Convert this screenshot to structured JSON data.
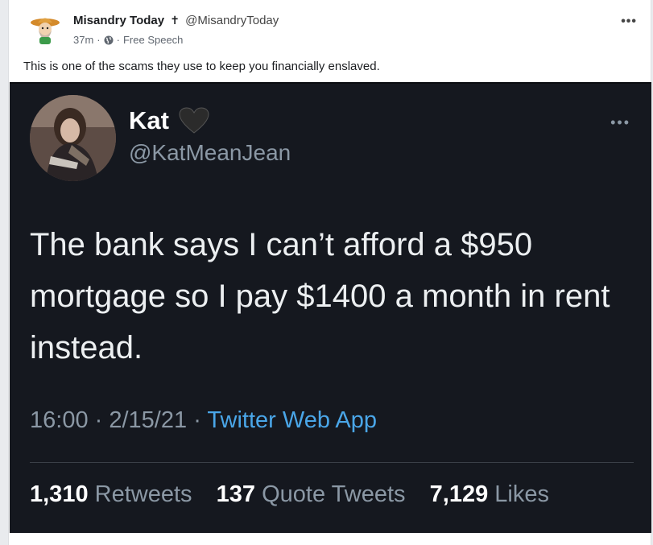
{
  "post": {
    "author_name": "Misandry Today",
    "author_cross": "✝",
    "author_handle": "@MisandryToday",
    "time": "37m",
    "separator": "·",
    "audience": "Free Speech",
    "more": "•••",
    "caption": "This is one of the scams they use to keep you financially enslaved."
  },
  "tweet": {
    "name": "Kat",
    "handle": "@KatMeanJean",
    "more": "•••",
    "text": "The bank says I can’t afford a $950 mortgage so I pay $1400 a month in rent instead.",
    "time": "16:00",
    "date": "2/15/21",
    "source": "Twitter Web App",
    "retweets_count": "1,310",
    "retweets_label": "Retweets",
    "quotes_count": "137",
    "quotes_label": "Quote Tweets",
    "likes_count": "7,129",
    "likes_label": "Likes"
  },
  "colors": {
    "tweet_bg": "#15181f",
    "link": "#4aa6e8",
    "muted": "#8b98a5"
  }
}
